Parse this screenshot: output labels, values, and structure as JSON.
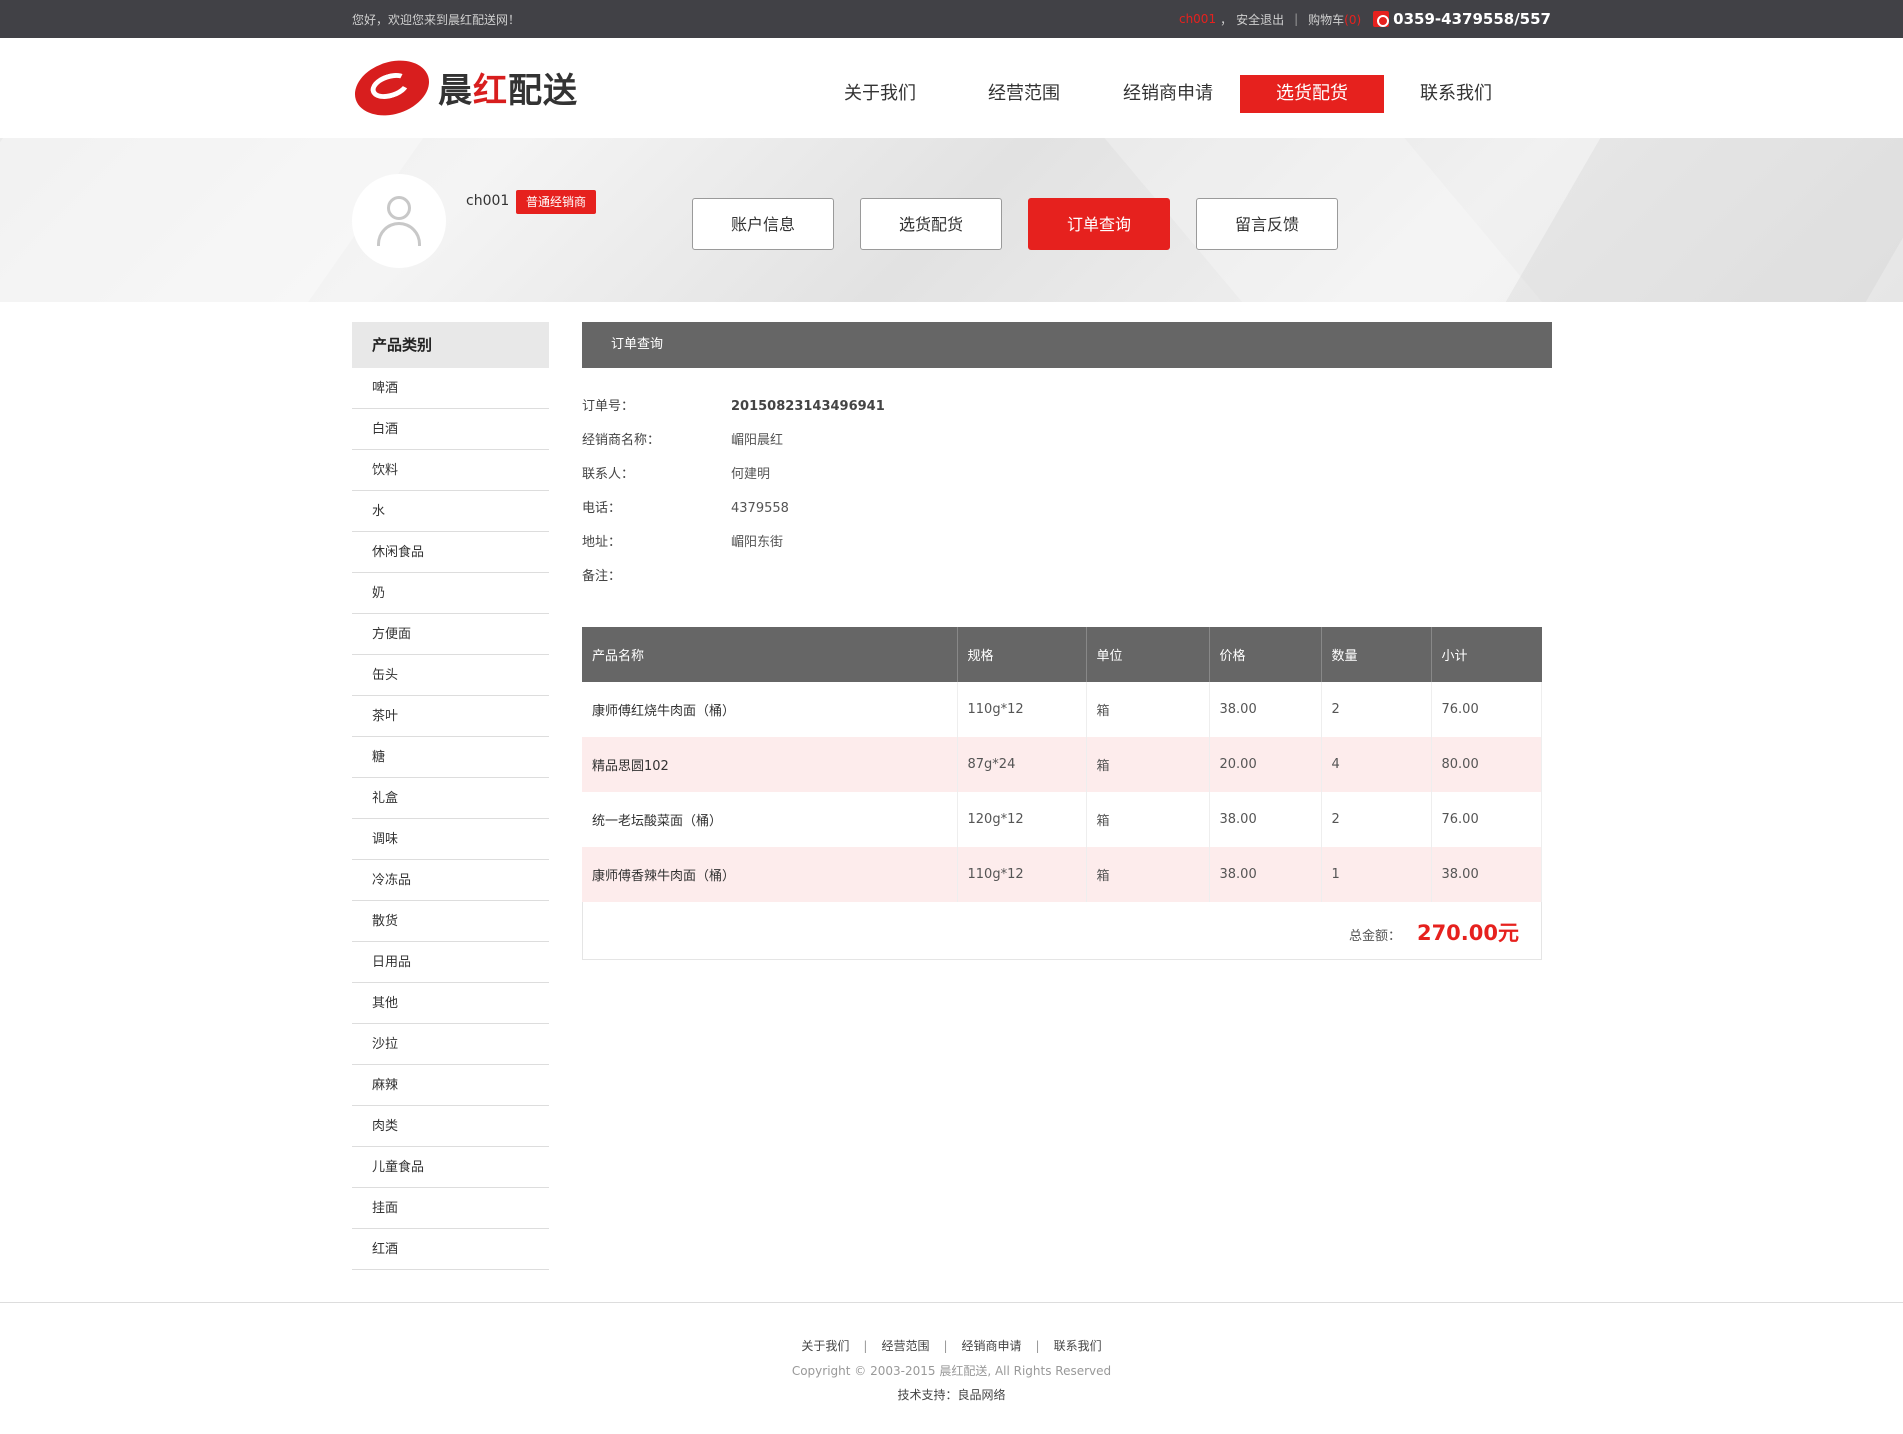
{
  "topbar": {
    "welcome": "您好，欢迎您来到晨红配送网！",
    "user_link": "ch001",
    "comma": "，",
    "logout": "安全退出",
    "separator": "|",
    "cart_label": "购物车",
    "cart_count": "(0)",
    "phone": "0359-4379558/557"
  },
  "header": {
    "logo_text_1": "晨",
    "logo_text_2": "红",
    "logo_text_3": "配送",
    "nav": [
      "关于我们",
      "经营范围",
      "经销商申请",
      "选货配货",
      "联系我们"
    ],
    "nav_active_index": 3
  },
  "user": {
    "name": "ch001",
    "badge": "普通经销商",
    "tabs": [
      "账户信息",
      "选货配货",
      "订单查询",
      "留言反馈"
    ],
    "active_tab_index": 2
  },
  "sidebar": {
    "title": "产品类别",
    "items": [
      "啤酒",
      "白酒",
      "饮料",
      "水",
      "休闲食品",
      "奶",
      "方便面",
      "缶头",
      "茶叶",
      "糖",
      "礼盒",
      "调味",
      "冷冻品",
      "散货",
      "日用品",
      "其他",
      "沙拉",
      "麻辣",
      "肉类",
      "儿童食品",
      "挂面",
      "红酒"
    ]
  },
  "order": {
    "section_title": "订单查询",
    "fields": [
      {
        "key": "订单号：",
        "value": "2015082314349694​1"
      },
      {
        "key": "经销商名称：",
        "value": "嵋阳晨红"
      },
      {
        "key": "联系人：",
        "value": "何建明"
      },
      {
        "key": "电话：",
        "value": "4379558"
      },
      {
        "key": "地址：",
        "value": "嵋阳东街"
      },
      {
        "key": "备注：",
        "value": ""
      }
    ],
    "table_headers": [
      "产品名称",
      "规格",
      "单位",
      "价格",
      "数量",
      "小计"
    ],
    "rows": [
      [
        "康师傅红烧牛肉面（桶）",
        "110g*12",
        "箱",
        "38.00",
        "2",
        "76.00"
      ],
      [
        "精品思圆102",
        "87g*24",
        "箱",
        "20.00",
        "4",
        "80.00"
      ],
      [
        "统一老坛酸菜面（桶）",
        "120g*12",
        "箱",
        "38.00",
        "2",
        "76.00"
      ],
      [
        "康师傅香辣牛肉面（桶）",
        "110g*12",
        "箱",
        "38.00",
        "1",
        "38.00"
      ]
    ],
    "total_label": "总金额：",
    "total_amount": "270.00元"
  },
  "footer": {
    "links": [
      "关于我们",
      "经营范围",
      "经销商申请",
      "联系我们"
    ],
    "link_separator": "|",
    "copyright": "Copyright © 2003-2015 晨红配送, All Rights Reserved",
    "support": "技术支持：良品网络"
  },
  "colors": {
    "accent": "#e6211e",
    "topbar": "#414146",
    "table_header": "#666666",
    "alt_row": "#fdecec"
  }
}
